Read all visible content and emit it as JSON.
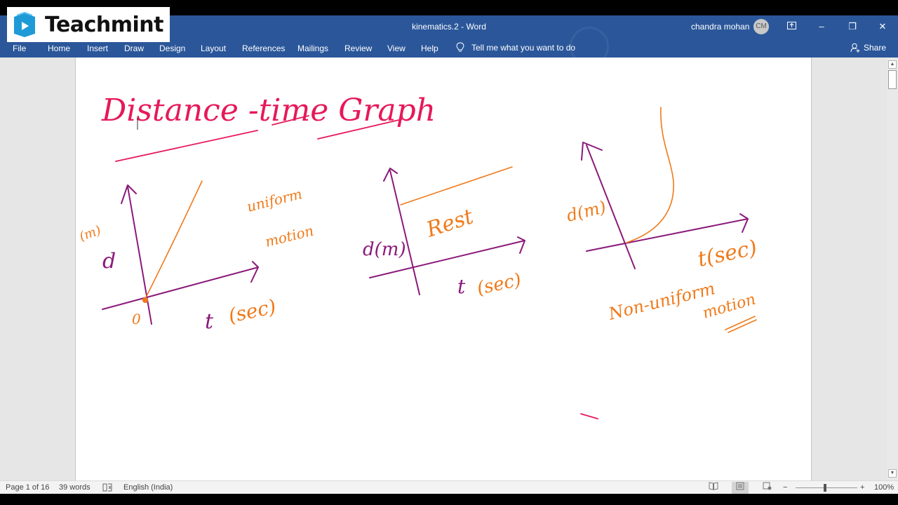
{
  "logo": {
    "brand": "Teachmint",
    "icon": "teachmint-book-play-icon"
  },
  "titlebar": {
    "doc_title": "kinematics.2  -  Word",
    "user_name": "chandra mohan",
    "user_initials": "CM",
    "controls": {
      "ribbon_display": "ribbon-display-options-icon",
      "minimize": "–",
      "restore": "❐",
      "close": "✕"
    }
  },
  "ribbon": {
    "tabs": [
      {
        "label": "File"
      },
      {
        "label": "Home"
      },
      {
        "label": "Insert"
      },
      {
        "label": "Draw"
      },
      {
        "label": "Design"
      },
      {
        "label": "Layout"
      },
      {
        "label": "References"
      },
      {
        "label": "Mailings"
      },
      {
        "label": "Review"
      },
      {
        "label": "View"
      },
      {
        "label": "Help"
      }
    ],
    "tell_me": "Tell me what you want to do",
    "share": "Share"
  },
  "document": {
    "heading": "Distance -time Graph",
    "graphs": [
      {
        "name": "uniform",
        "y_label": "d",
        "y_unit": "(m)",
        "x_label": "t",
        "x_unit": "(sec)",
        "origin": "0",
        "caption_line1": "uniform",
        "caption_line2": "motion"
      },
      {
        "name": "rest",
        "y_label": "d(m)",
        "x_label": "t",
        "x_unit": "(sec)",
        "caption": "Rest"
      },
      {
        "name": "non-uniform",
        "y_label": "d(m)",
        "x_label": "t(sec)",
        "caption_line1": "Non-uniform",
        "caption_line2": "motion"
      }
    ]
  },
  "statusbar": {
    "page": "Page 1 of 16",
    "words": "39 words",
    "language": "English (India)",
    "zoom_level": "100%",
    "zoom_minus": "−",
    "zoom_plus": "+"
  },
  "colors": {
    "word_blue": "#2b579a",
    "ink_magenta": "#8b1a7a",
    "ink_orange": "#f07a1a",
    "ink_pink": "#e6195a"
  }
}
